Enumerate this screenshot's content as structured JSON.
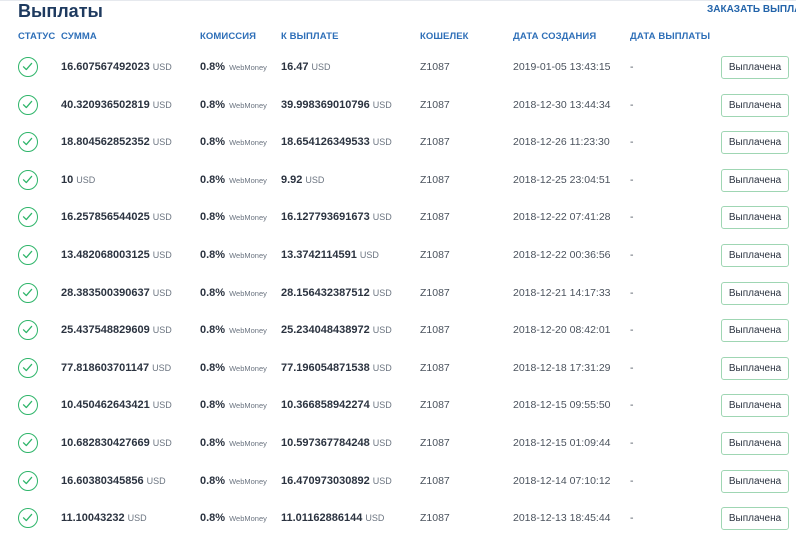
{
  "page": {
    "title": "Выплаты",
    "order_link": "ЗАКАЗАТЬ ВЫПЛАТУ"
  },
  "columns": {
    "status": "СТАТУС",
    "amount": "СУММА",
    "fee": "КОМИССИЯ",
    "payout": "К ВЫПЛАТЕ",
    "wallet": "КОШЕЛЕК",
    "created": "ДАТА СОЗДАНИЯ",
    "paid": "ДАТА ВЫПЛАТЫ"
  },
  "colors": {
    "accent": "#2e6fb8",
    "success": "#2fb56a",
    "title": "#1e3a5f"
  },
  "rows": [
    {
      "status": "check-circle-icon",
      "amount": "16.607567492023",
      "currency": "USD",
      "fee": "0.8%",
      "fee_method": "WebMoney",
      "payout": "16.47",
      "wallet": "Z1087",
      "created": "2019-01-05 13:43:15",
      "paid": "-",
      "status_label": "Выплачена"
    },
    {
      "status": "check-circle-icon",
      "amount": "40.320936502819",
      "currency": "USD",
      "fee": "0.8%",
      "fee_method": "WebMoney",
      "payout": "39.998369010796",
      "wallet": "Z1087",
      "created": "2018-12-30 13:44:34",
      "paid": "-",
      "status_label": "Выплачена"
    },
    {
      "status": "check-circle-icon",
      "amount": "18.804562852352",
      "currency": "USD",
      "fee": "0.8%",
      "fee_method": "WebMoney",
      "payout": "18.654126349533",
      "wallet": "Z1087",
      "created": "2018-12-26 11:23:30",
      "paid": "-",
      "status_label": "Выплачена"
    },
    {
      "status": "check-circle-icon",
      "amount": "10",
      "currency": "USD",
      "fee": "0.8%",
      "fee_method": "WebMoney",
      "payout": "9.92",
      "wallet": "Z1087",
      "created": "2018-12-25 23:04:51",
      "paid": "-",
      "status_label": "Выплачена"
    },
    {
      "status": "check-circle-icon",
      "amount": "16.257856544025",
      "currency": "USD",
      "fee": "0.8%",
      "fee_method": "WebMoney",
      "payout": "16.127793691673",
      "wallet": "Z1087",
      "created": "2018-12-22 07:41:28",
      "paid": "-",
      "status_label": "Выплачена"
    },
    {
      "status": "check-circle-icon",
      "amount": "13.482068003125",
      "currency": "USD",
      "fee": "0.8%",
      "fee_method": "WebMoney",
      "payout": "13.3742114591",
      "wallet": "Z1087",
      "created": "2018-12-22 00:36:56",
      "paid": "-",
      "status_label": "Выплачена"
    },
    {
      "status": "check-circle-icon",
      "amount": "28.383500390637",
      "currency": "USD",
      "fee": "0.8%",
      "fee_method": "WebMoney",
      "payout": "28.156432387512",
      "wallet": "Z1087",
      "created": "2018-12-21 14:17:33",
      "paid": "-",
      "status_label": "Выплачена"
    },
    {
      "status": "check-circle-icon",
      "amount": "25.437548829609",
      "currency": "USD",
      "fee": "0.8%",
      "fee_method": "WebMoney",
      "payout": "25.234048438972",
      "wallet": "Z1087",
      "created": "2018-12-20 08:42:01",
      "paid": "-",
      "status_label": "Выплачена"
    },
    {
      "status": "check-circle-icon",
      "amount": "77.818603701147",
      "currency": "USD",
      "fee": "0.8%",
      "fee_method": "WebMoney",
      "payout": "77.196054871538",
      "wallet": "Z1087",
      "created": "2018-12-18 17:31:29",
      "paid": "-",
      "status_label": "Выплачена"
    },
    {
      "status": "check-circle-icon",
      "amount": "10.450462643421",
      "currency": "USD",
      "fee": "0.8%",
      "fee_method": "WebMoney",
      "payout": "10.366858942274",
      "wallet": "Z1087",
      "created": "2018-12-15 09:55:50",
      "paid": "-",
      "status_label": "Выплачена"
    },
    {
      "status": "check-circle-icon",
      "amount": "10.682830427669",
      "currency": "USD",
      "fee": "0.8%",
      "fee_method": "WebMoney",
      "payout": "10.597367784248",
      "wallet": "Z1087",
      "created": "2018-12-15 01:09:44",
      "paid": "-",
      "status_label": "Выплачена"
    },
    {
      "status": "check-circle-icon",
      "amount": "16.60380345856",
      "currency": "USD",
      "fee": "0.8%",
      "fee_method": "WebMoney",
      "payout": "16.470973030892",
      "wallet": "Z1087",
      "created": "2018-12-14 07:10:12",
      "paid": "-",
      "status_label": "Выплачена"
    },
    {
      "status": "check-circle-icon",
      "amount": "11.10043232",
      "currency": "USD",
      "fee": "0.8%",
      "fee_method": "WebMoney",
      "payout": "11.01162886144",
      "wallet": "Z1087",
      "created": "2018-12-13 18:45:44",
      "paid": "-",
      "status_label": "Выплачена"
    }
  ]
}
